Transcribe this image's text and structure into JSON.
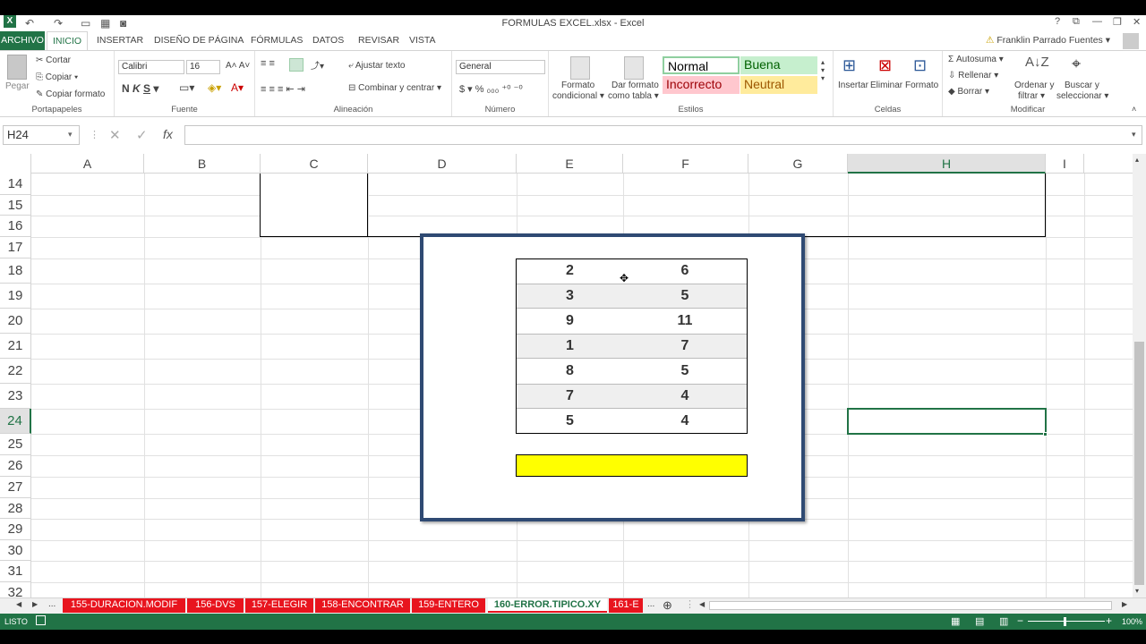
{
  "window": {
    "title": "FORMULAS EXCEL.xlsx - Excel",
    "user": "Franklin Parrado Fuentes"
  },
  "tabs": [
    "ARCHIVO",
    "INICIO",
    "INSERTAR",
    "DISEÑO DE PÁGINA",
    "FÓRMULAS",
    "DATOS",
    "REVISAR",
    "VISTA"
  ],
  "ribbon": {
    "portapapeles": {
      "label": "Portapapeles",
      "pegar": "Pegar",
      "cortar": "Cortar",
      "copiar": "Copiar",
      "copiar_formato": "Copiar formato"
    },
    "fuente": {
      "label": "Fuente",
      "font": "Calibri",
      "size": "16"
    },
    "alineacion": {
      "label": "Alineación",
      "ajustar": "Ajustar texto",
      "combinar": "Combinar y centrar"
    },
    "numero": {
      "label": "Número",
      "format": "General"
    },
    "estilos": {
      "label": "Estilos",
      "formato_condicional_1": "Formato",
      "formato_condicional_2": "condicional",
      "dar_formato_1": "Dar formato",
      "dar_formato_2": "como tabla",
      "normal": "Normal",
      "buena": "Buena",
      "incorrecto": "Incorrecto",
      "neutral": "Neutral"
    },
    "celdas": {
      "label": "Celdas",
      "insertar": "Insertar",
      "eliminar": "Eliminar",
      "formato": "Formato"
    },
    "modificar": {
      "label": "Modificar",
      "autosuma": "Autosuma",
      "rellenar": "Rellenar",
      "borrar": "Borrar",
      "ordenar_1": "Ordenar y",
      "ordenar_2": "filtrar",
      "buscar_1": "Buscar y",
      "buscar_2": "seleccionar"
    }
  },
  "formula_bar": {
    "namebox": "H24",
    "fx": "fx",
    "value": ""
  },
  "columns": [
    "A",
    "B",
    "C",
    "D",
    "E",
    "F",
    "G",
    "H",
    "I"
  ],
  "rows": [
    "14",
    "15",
    "16",
    "17",
    "18",
    "19",
    "20",
    "21",
    "22",
    "23",
    "24",
    "25",
    "26",
    "27",
    "28",
    "29",
    "30",
    "31",
    "32"
  ],
  "table": [
    [
      "2",
      "6"
    ],
    [
      "3",
      "5"
    ],
    [
      "9",
      "11"
    ],
    [
      "1",
      "7"
    ],
    [
      "8",
      "5"
    ],
    [
      "7",
      "4"
    ],
    [
      "5",
      "4"
    ]
  ],
  "sheets": [
    "...",
    "155-DURACION.MODIF",
    "156-DVS",
    "157-ELEGIR",
    "158-ENCONTRAR",
    "159-ENTERO",
    "160-ERROR.TIPICO.XY",
    "161-E",
    "..."
  ],
  "status": {
    "mode": "LISTO",
    "zoom": "100%"
  },
  "colors": {
    "accent": "#217346",
    "sheet_tab": "#e8141e",
    "highlight": "#ffff00",
    "frame": "#2f4a73"
  }
}
